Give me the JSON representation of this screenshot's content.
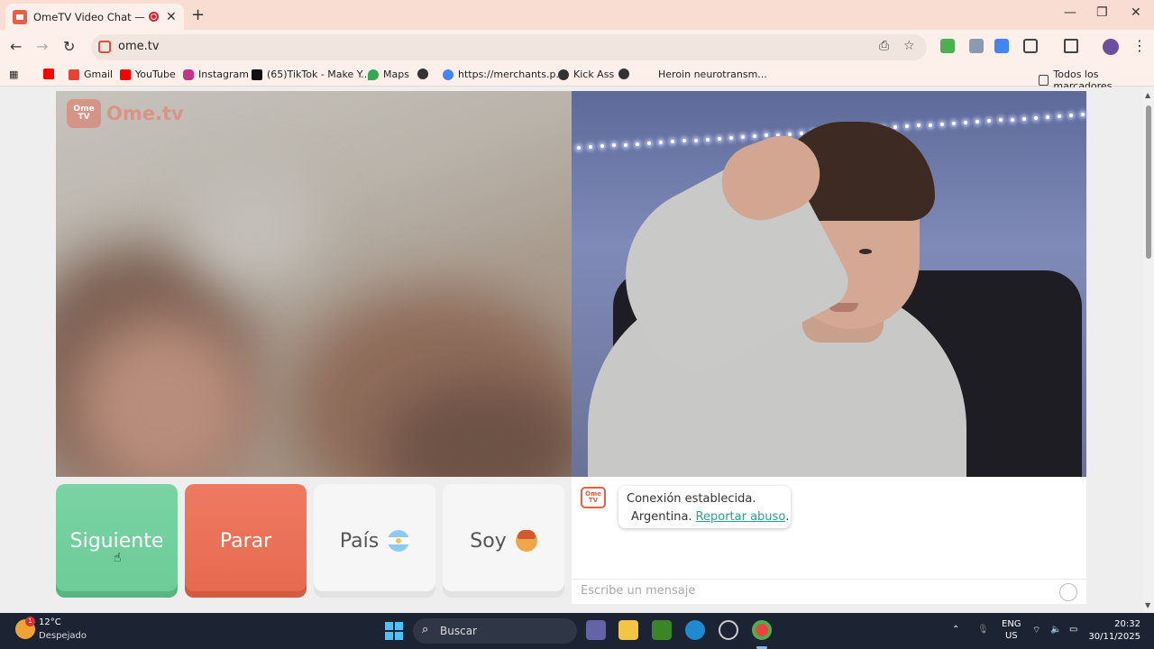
{
  "browser": {
    "tab_title": "OmeTV Video Chat — Ome",
    "new_tab": "+",
    "url": "ome.tv",
    "bookmarks": [
      {
        "label": "",
        "icon": "youtube-icon",
        "color": "#ff0000"
      },
      {
        "label": "Gmail",
        "icon": "gmail-icon",
        "color": "#ea4335"
      },
      {
        "label": "YouTube",
        "icon": "youtube-icon",
        "color": "#ff0000"
      },
      {
        "label": "Instagram",
        "icon": "instagram-icon",
        "color": "#c13584"
      },
      {
        "label": "(65)TikTok - Make Y...",
        "icon": "tiktok-icon",
        "color": "#111111"
      },
      {
        "label": "Maps",
        "icon": "maps-icon",
        "color": "#34a853"
      },
      {
        "label": "",
        "icon": "globe-icon",
        "color": "#333333"
      },
      {
        "label": "https://merchants.p...",
        "icon": "google-icon",
        "color": "#4285f4"
      },
      {
        "label": "Kick Ass",
        "icon": "globe-icon",
        "color": "#333333"
      },
      {
        "label": "",
        "icon": "globe-icon",
        "color": "#333333"
      },
      {
        "label": "Heroin neurotransm...",
        "icon": "",
        "color": ""
      }
    ],
    "all_bookmarks": "Todos los marcadores"
  },
  "site": {
    "logo_badge": "Ome TV",
    "logo_text": "Ome.tv"
  },
  "controls": {
    "next": "Siguiente",
    "stop": "Parar",
    "country": "País",
    "soy": "Soy"
  },
  "chat": {
    "logo_badge": "Ome TV",
    "status": "Conexión establecida.",
    "country": "Argentina.",
    "report_link": "Reportar abuso",
    "report_suffix": ".",
    "input_placeholder": "Escribe un mensaje"
  },
  "taskbar": {
    "temperature": "12°C",
    "condition": "Despejado",
    "weather_badge": "1",
    "search_label": "Buscar",
    "lang_line1": "ENG",
    "lang_line2": "US",
    "time": "20:32",
    "date": "30/11/2025"
  },
  "colors": {
    "next_button": "#6fcf99",
    "stop_button": "#e86d52",
    "link": "#2d9f8a",
    "brand": "#e85f48"
  }
}
